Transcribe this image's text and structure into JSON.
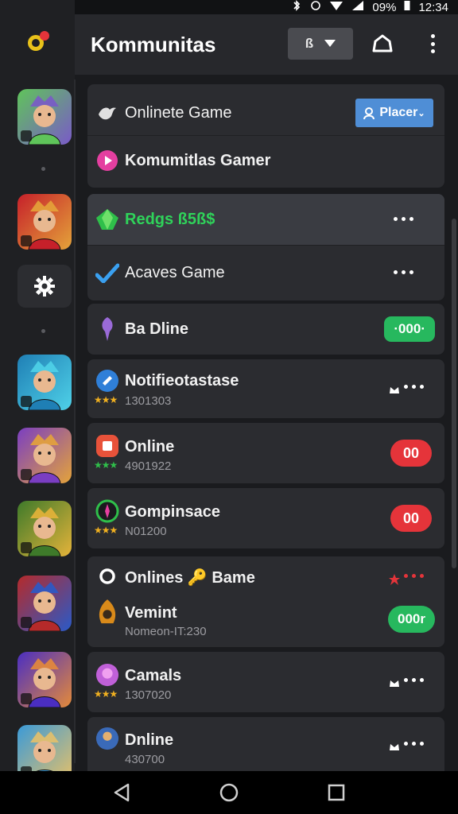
{
  "status_bar": {
    "battery": "09%",
    "time": "12:34"
  },
  "app": {
    "title": "Kommunitas",
    "select_label": "ß"
  },
  "rail": {
    "items": [
      {
        "name": "game-avatar-1",
        "colors": [
          "#5fc45a",
          "#7a5ac8"
        ]
      },
      {
        "name": "game-avatar-2",
        "colors": [
          "#c6202a",
          "#e4a33a"
        ]
      },
      {
        "name": "game-avatar-3",
        "colors": [
          "#1f7fb5",
          "#4fd1e8"
        ]
      },
      {
        "name": "game-avatar-4",
        "colors": [
          "#7a3ec2",
          "#e4a33a"
        ]
      },
      {
        "name": "game-avatar-5",
        "colors": [
          "#3e7a2a",
          "#e4b33a"
        ]
      },
      {
        "name": "game-avatar-6",
        "colors": [
          "#b52a2a",
          "#2a5ac8"
        ]
      },
      {
        "name": "game-avatar-7",
        "colors": [
          "#4a2ec2",
          "#e48a3a"
        ]
      },
      {
        "name": "game-avatar-8",
        "colors": [
          "#3a9ad8",
          "#e4c06a"
        ]
      }
    ]
  },
  "cards": {
    "c1": {
      "row1_label": "Onlinete Game",
      "row1_button": "Placer",
      "row2_label": "Komumitlas Gamer"
    },
    "c2": {
      "row1_label": "Redgs ß5ß$",
      "row2_label": "Acaves Game"
    },
    "c3": {
      "label": "Ba Dline",
      "badge": "·000·"
    },
    "c4": {
      "label": "Notifieotastase",
      "stars": "★★★",
      "sub": "1301303"
    },
    "c5": {
      "label": "Online",
      "stars": "★★★",
      "sub": "4901922",
      "badge": "00"
    },
    "c6": {
      "label": "Gompinsace",
      "stars": "★★★",
      "sub": "N01200",
      "badge": "00"
    },
    "c7": {
      "row1_label": "Onlines 🔑 Bame",
      "row2_label": "Vemint",
      "row2_sub": "Nomeon-IT:230",
      "badge": "000r"
    },
    "c8": {
      "label": "Camals",
      "stars": "★★★",
      "sub": "1307020"
    },
    "c9": {
      "label": "Dnline",
      "sub": "430700"
    }
  },
  "colors": {
    "accent_blue": "#4f8ed6",
    "green": "#27b85e",
    "red": "#e5343a",
    "highlight": "#3a3c42"
  }
}
